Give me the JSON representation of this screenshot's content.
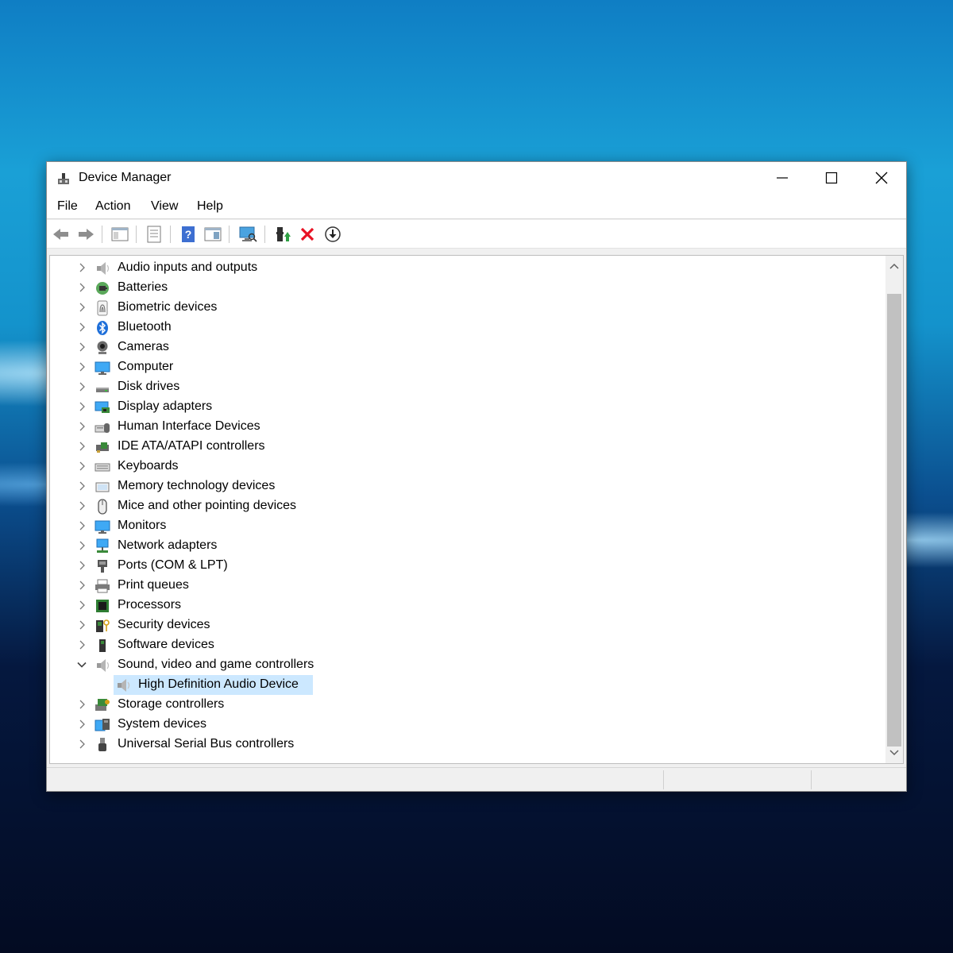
{
  "window": {
    "title": "Device Manager"
  },
  "menu": {
    "items": [
      "File",
      "Action",
      "View",
      "Help"
    ]
  },
  "toolbar": {
    "buttons": [
      "back-icon",
      "forward-icon",
      "show-hide-console-tree-icon",
      "properties-icon",
      "help-icon",
      "action-pane-icon",
      "scan-hardware-icon",
      "update-driver-icon",
      "uninstall-icon",
      "disable-icon"
    ],
    "uninstall_color": "#e81123"
  },
  "tree": {
    "categories": [
      {
        "label": "Audio inputs and outputs",
        "icon": "speaker-icon"
      },
      {
        "label": "Batteries",
        "icon": "battery-icon"
      },
      {
        "label": "Biometric devices",
        "icon": "fingerprint-icon"
      },
      {
        "label": "Bluetooth",
        "icon": "bluetooth-icon"
      },
      {
        "label": "Cameras",
        "icon": "camera-icon"
      },
      {
        "label": "Computer",
        "icon": "computer-icon"
      },
      {
        "label": "Disk drives",
        "icon": "disk-drive-icon"
      },
      {
        "label": "Display adapters",
        "icon": "display-adapter-icon"
      },
      {
        "label": "Human Interface Devices",
        "icon": "hid-icon"
      },
      {
        "label": "IDE ATA/ATAPI controllers",
        "icon": "ide-controller-icon"
      },
      {
        "label": "Keyboards",
        "icon": "keyboard-icon"
      },
      {
        "label": "Memory technology devices",
        "icon": "memory-icon"
      },
      {
        "label": "Mice and other pointing devices",
        "icon": "mouse-icon"
      },
      {
        "label": "Monitors",
        "icon": "monitor-icon"
      },
      {
        "label": "Network adapters",
        "icon": "network-icon"
      },
      {
        "label": "Ports (COM & LPT)",
        "icon": "port-icon"
      },
      {
        "label": "Print queues",
        "icon": "printer-icon"
      },
      {
        "label": "Processors",
        "icon": "processor-icon"
      },
      {
        "label": "Security devices",
        "icon": "security-icon"
      },
      {
        "label": "Software devices",
        "icon": "software-device-icon"
      },
      {
        "label": "Sound, video and game controllers",
        "icon": "speaker-icon",
        "expanded": true,
        "children": [
          {
            "label": "High Definition Audio Device",
            "icon": "speaker-icon",
            "selected": true
          }
        ]
      },
      {
        "label": "Storage controllers",
        "icon": "storage-icon"
      },
      {
        "label": "System devices",
        "icon": "system-device-icon"
      },
      {
        "label": "Universal Serial Bus controllers",
        "icon": "usb-icon"
      }
    ],
    "selection_color": "#cce8ff"
  }
}
